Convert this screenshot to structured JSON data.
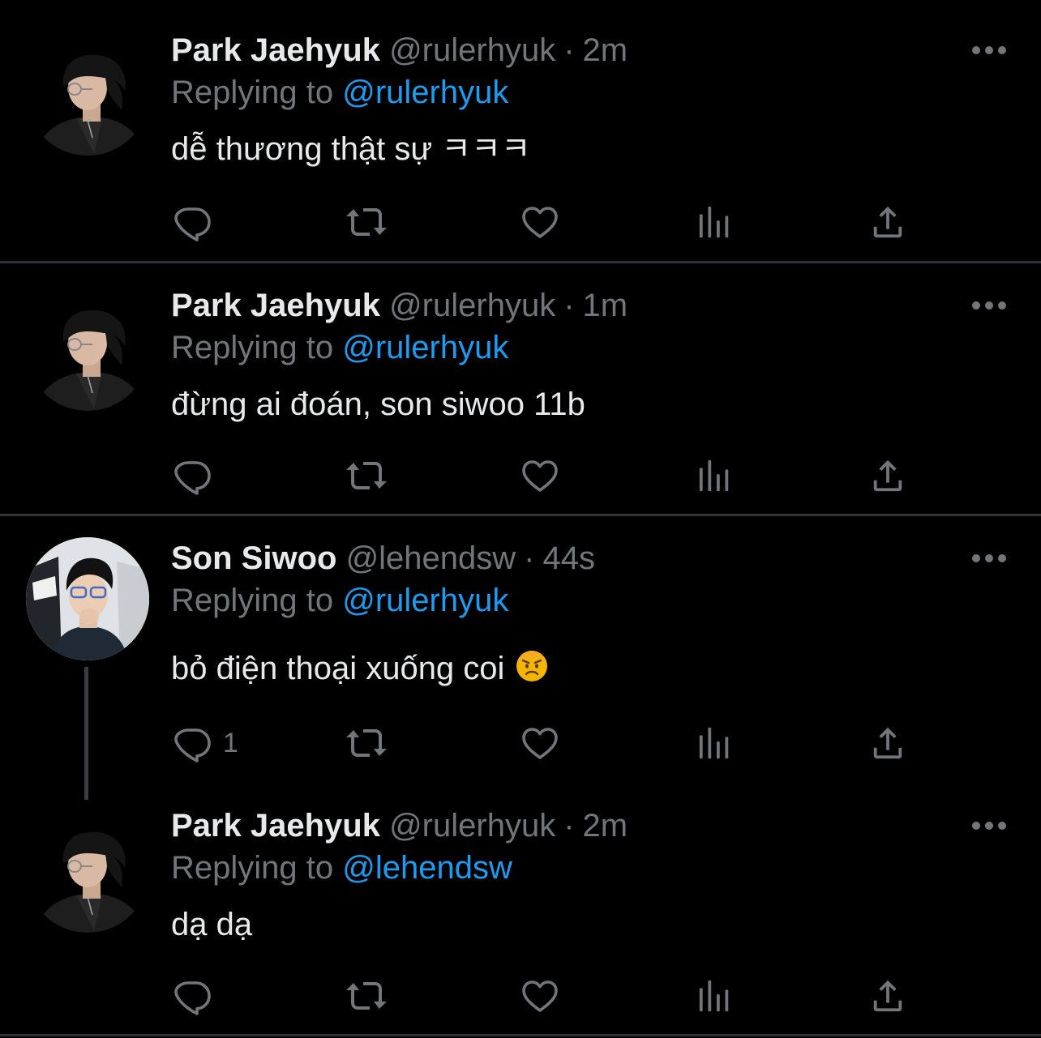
{
  "tweets": [
    {
      "name": "Park Jaehyuk",
      "handle": "@rulerhyuk",
      "dot": "·",
      "time": "2m",
      "replying_prefix": "Replying to",
      "replying_handle": "@rulerhyuk",
      "text": "dễ thương thật sự ㅋㅋㅋ",
      "reply_count": ""
    },
    {
      "name": "Park Jaehyuk",
      "handle": "@rulerhyuk",
      "dot": "·",
      "time": "1m",
      "replying_prefix": "Replying to",
      "replying_handle": "@rulerhyuk",
      "text": "đừng ai đoán, son siwoo 11b",
      "reply_count": ""
    },
    {
      "name": "Son Siwoo",
      "handle": "@lehendsw",
      "dot": "·",
      "time": "44s",
      "replying_prefix": "Replying to",
      "replying_handle": "@rulerhyuk",
      "text": "bỏ điện thoại xuống coi",
      "emoji": "angry-face-icon",
      "reply_count": "1"
    },
    {
      "name": "Park Jaehyuk",
      "handle": "@rulerhyuk",
      "dot": "·",
      "time": "2m",
      "replying_prefix": "Replying to",
      "replying_handle": "@lehendsw",
      "text": "dạ dạ",
      "reply_count": ""
    }
  ],
  "colors": {
    "background": "#000000",
    "primary_text": "#e7e9ea",
    "secondary_text": "#71767b",
    "link": "#1d9bf0",
    "divider": "#2f3336"
  },
  "icons": [
    "reply-icon",
    "retweet-icon",
    "like-icon",
    "views-icon",
    "share-icon",
    "more-icon"
  ]
}
